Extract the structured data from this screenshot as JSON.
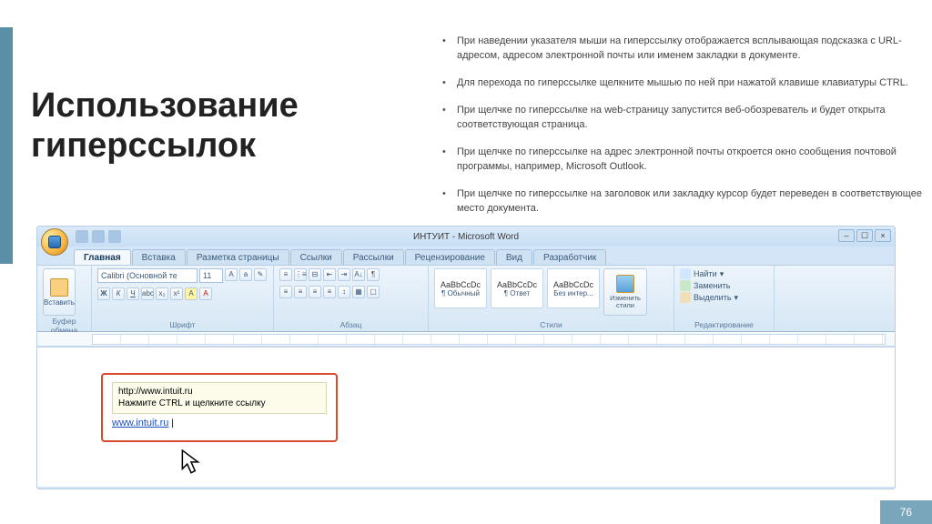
{
  "slide": {
    "title": "Использование гиперссылок",
    "page_number": "76",
    "bullets": [
      "При наведении указателя мыши на гиперссылку отображается всплывающая подсказка с URL-адресом, адресом электронной почты или именем закладки в документе.",
      "Для перехода по гиперссылке щелкните мышью по ней при нажатой клавише клавиатуры CTRL.",
      "При щелчке по гиперссылке на web-страницу запустится веб-обозреватель и будет открыта соответствующая страница.",
      "При щелчке по гиперссылке на адрес электронной почты откроется окно сообщения почтовой программы, например, Microsoft Outlook.",
      "При щелчке по гиперссылке на заголовок или закладку курсор будет переведен в соответствующее место документа."
    ]
  },
  "word": {
    "window_title": "ИНТУИТ - Microsoft Word",
    "tabs": [
      "Главная",
      "Вставка",
      "Разметка страницы",
      "Ссылки",
      "Рассылки",
      "Рецензирование",
      "Вид",
      "Разработчик"
    ],
    "active_tab": "Главная",
    "groups": {
      "clipboard": {
        "label": "Буфер обмена",
        "paste": "Вставить"
      },
      "font": {
        "label": "Шрифт",
        "name": "Calibri (Основной те",
        "size": "11"
      },
      "paragraph": {
        "label": "Абзац"
      },
      "styles": {
        "label": "Стили",
        "tiles": [
          {
            "sample": "AaBbCcDc",
            "name": "¶ Обычный"
          },
          {
            "sample": "AaBbCcDc",
            "name": "¶ Ответ"
          },
          {
            "sample": "AaBbCcDc",
            "name": "Без интер..."
          }
        ],
        "change": "Изменить стили"
      },
      "editing": {
        "label": "Редактирование",
        "find": "Найти",
        "replace": "Заменить",
        "select": "Выделить"
      }
    },
    "tooltip": {
      "url": "http://www.intuit.ru",
      "hint": "Нажмите CTRL и щелкните ссылку"
    },
    "link_text": "www.intuit.ru"
  }
}
